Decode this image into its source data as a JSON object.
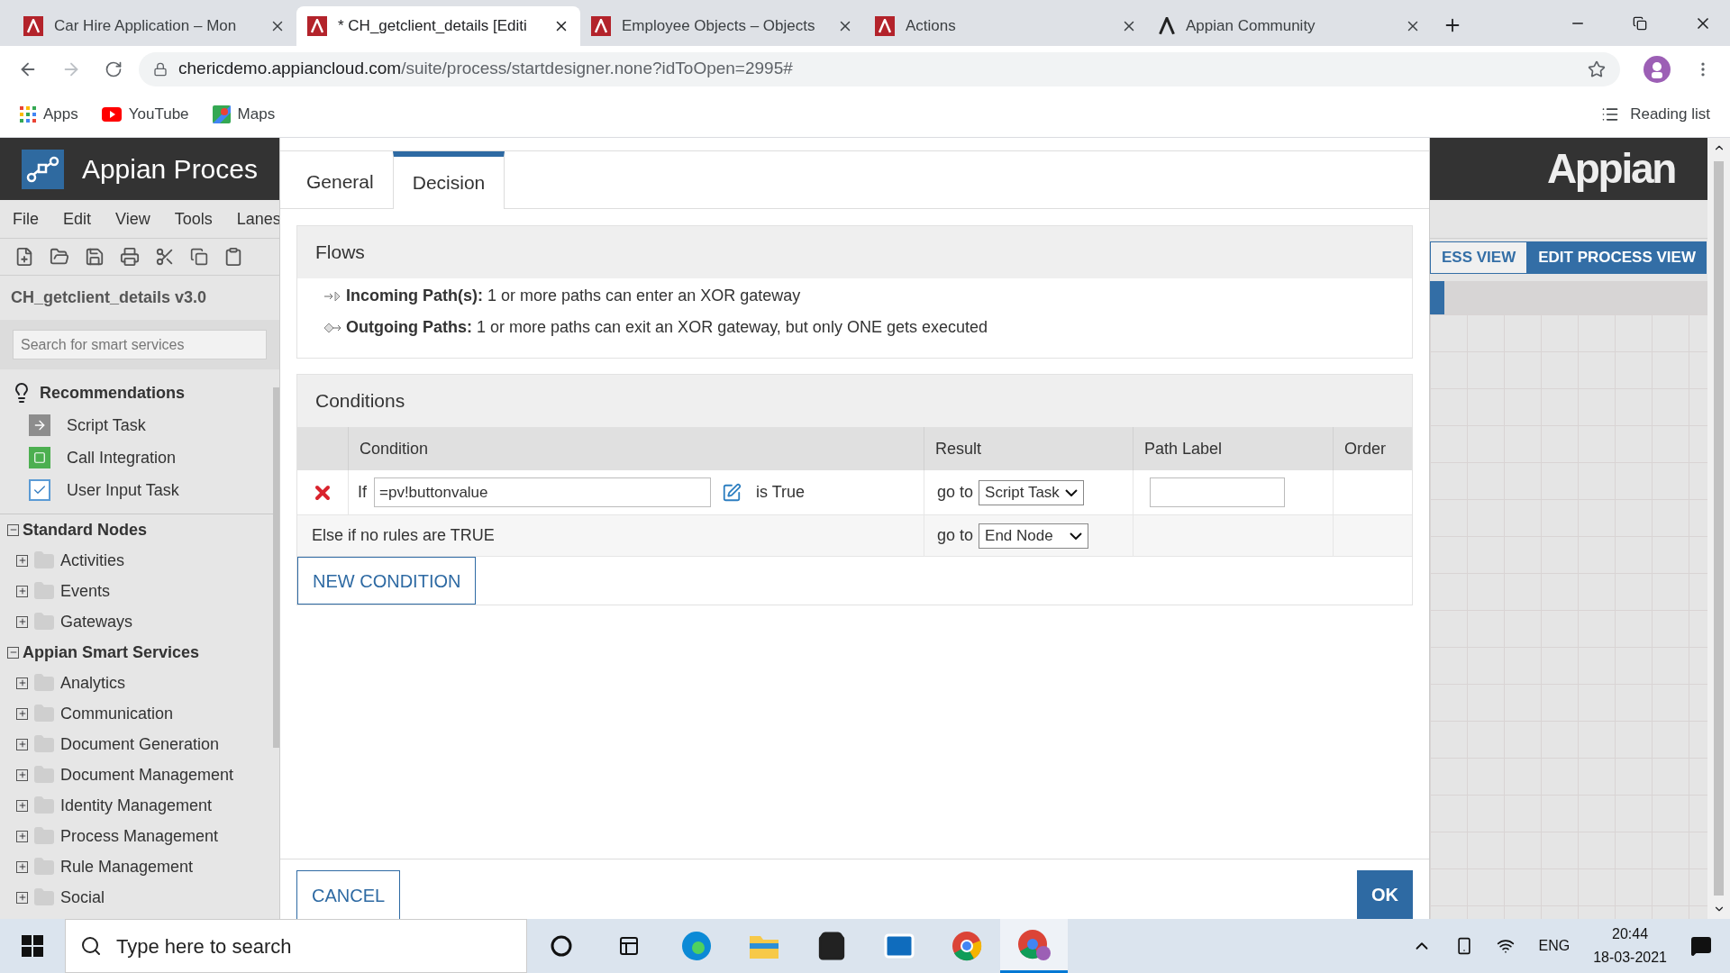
{
  "browser": {
    "tabs": [
      {
        "title": "Car Hire Application – Mon",
        "selected": false,
        "kind": "appian"
      },
      {
        "title": "* CH_getclient_details [Editi",
        "selected": true,
        "kind": "appian"
      },
      {
        "title": "Employee Objects – Objects",
        "selected": false,
        "kind": "appian"
      },
      {
        "title": "Actions",
        "selected": false,
        "kind": "appian"
      },
      {
        "title": "Appian Community",
        "selected": false,
        "kind": "community"
      }
    ],
    "address": {
      "domain": "chericdemo.appiancloud.com",
      "path": "/suite/process/startdesigner.none?idToOpen=2995#"
    },
    "bookmarks": [
      {
        "label": "Apps",
        "kind": "apps"
      },
      {
        "label": "YouTube",
        "kind": "youtube"
      },
      {
        "label": "Maps",
        "kind": "maps"
      }
    ],
    "reading_list": "Reading list"
  },
  "left_panel": {
    "app_title": "Appian Proces",
    "menu": [
      "File",
      "Edit",
      "View",
      "Tools",
      "Lanes"
    ],
    "model_title": "CH_getclient_details v3.0",
    "search": {
      "placeholder": "Search for smart services"
    },
    "recommendations": {
      "title": "Recommendations",
      "items": [
        {
          "label": "Script Task",
          "kind": "script"
        },
        {
          "label": "Call Integration",
          "kind": "integration"
        },
        {
          "label": "User Input Task",
          "kind": "input"
        }
      ]
    },
    "groups": [
      {
        "title": "Standard Nodes",
        "expanded": true,
        "children": [
          {
            "label": "Activities",
            "expanded": false
          },
          {
            "label": "Events",
            "expanded": false
          },
          {
            "label": "Gateways",
            "expanded": false
          }
        ]
      },
      {
        "title": "Appian Smart Services",
        "expanded": true,
        "children": [
          {
            "label": "Analytics",
            "expanded": false
          },
          {
            "label": "Communication",
            "expanded": false
          },
          {
            "label": "Document Generation",
            "expanded": false
          },
          {
            "label": "Document Management",
            "expanded": false
          },
          {
            "label": "Identity Management",
            "expanded": false
          },
          {
            "label": "Process Management",
            "expanded": false
          },
          {
            "label": "Rule Management",
            "expanded": false
          },
          {
            "label": "Social",
            "expanded": false
          }
        ]
      }
    ]
  },
  "dialog": {
    "tabs": [
      {
        "label": "General",
        "selected": false
      },
      {
        "label": "Decision",
        "selected": true
      }
    ],
    "flows": {
      "title": "Flows",
      "items": [
        {
          "kind": "incoming",
          "label": "Incoming Path(s):",
          "text": "1 or more paths can enter an XOR gateway"
        },
        {
          "kind": "outgoing",
          "label": "Outgoing Paths:",
          "text": "1 or more paths can exit an XOR gateway, but only ONE gets executed"
        }
      ]
    },
    "conditions": {
      "title": "Conditions",
      "columns": [
        "Condition",
        "Result",
        "Path Label",
        "Order"
      ],
      "rows": [
        {
          "if": "If",
          "expression": "=pv!buttonvalue",
          "test": "is True",
          "go_to": "go to",
          "target": "Script Task"
        }
      ],
      "else_row": {
        "text": "Else if no rules are TRUE",
        "go_to": "go to",
        "target": "End Node"
      },
      "new_condition": "NEW CONDITION"
    },
    "cancel": "CANCEL",
    "ok": "OK"
  },
  "right_panel": {
    "logo": "Appian",
    "views": [
      {
        "label": "ESS VIEW",
        "selected": false
      },
      {
        "label": "EDIT PROCESS VIEW",
        "selected": true
      }
    ]
  },
  "taskbar": {
    "search": {
      "placeholder": "Type here to search"
    },
    "apps": [
      {
        "kind": "cortana",
        "selected": false
      },
      {
        "kind": "taskview",
        "selected": false
      },
      {
        "kind": "edge",
        "selected": false
      },
      {
        "kind": "explorer",
        "selected": false
      },
      {
        "kind": "store",
        "selected": false
      },
      {
        "kind": "mail",
        "selected": false
      },
      {
        "kind": "chrome",
        "selected": false
      },
      {
        "kind": "chrome-profile",
        "selected": true
      }
    ],
    "language": "ENG",
    "time": "20:44",
    "date": "18-03-2021"
  }
}
